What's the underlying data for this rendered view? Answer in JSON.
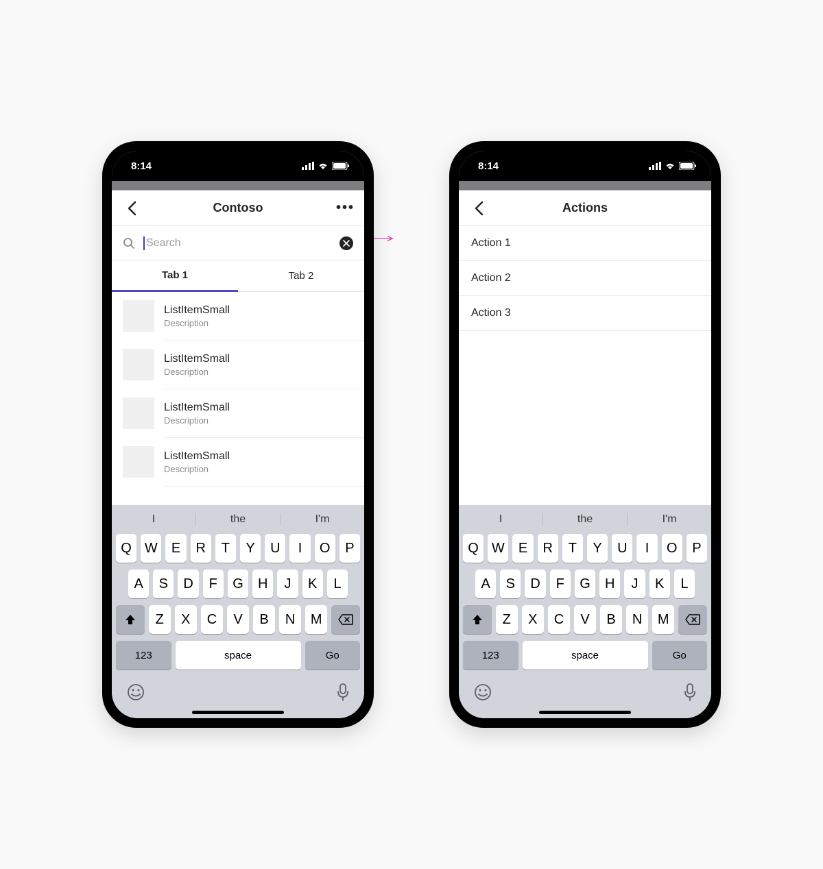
{
  "status": {
    "time": "8:14"
  },
  "screen1": {
    "title": "Contoso",
    "search_placeholder": "Search",
    "tabs": [
      "Tab 1",
      "Tab 2"
    ],
    "items": [
      {
        "title": "ListItemSmall",
        "desc": "Description"
      },
      {
        "title": "ListItemSmall",
        "desc": "Description"
      },
      {
        "title": "ListItemSmall",
        "desc": "Description"
      },
      {
        "title": "ListItemSmall",
        "desc": "Description"
      }
    ]
  },
  "screen2": {
    "title": "Actions",
    "actions": [
      "Action 1",
      "Action 2",
      "Action 3"
    ]
  },
  "keyboard": {
    "suggestions": [
      "I",
      "the",
      "I'm"
    ],
    "row1": [
      "Q",
      "W",
      "E",
      "R",
      "T",
      "Y",
      "U",
      "I",
      "O",
      "P"
    ],
    "row2": [
      "A",
      "S",
      "D",
      "F",
      "G",
      "H",
      "J",
      "K",
      "L"
    ],
    "row3": [
      "Z",
      "X",
      "C",
      "V",
      "B",
      "N",
      "M"
    ],
    "numeric_label": "123",
    "space_label": "space",
    "go_label": "Go"
  }
}
